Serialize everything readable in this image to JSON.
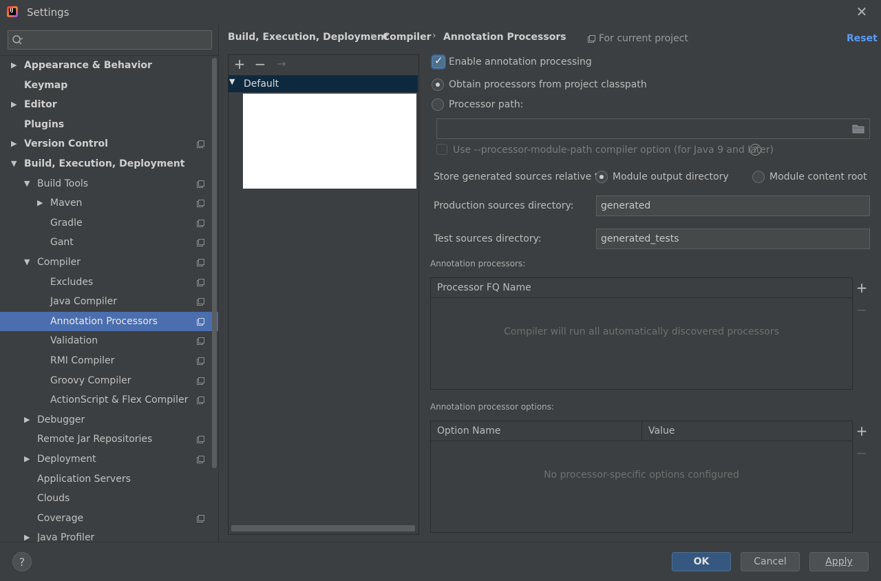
{
  "window": {
    "title": "Settings",
    "app_icon_text": "IJ"
  },
  "search": {
    "placeholder": ""
  },
  "sidebar": {
    "items": [
      {
        "label": "Appearance & Behavior",
        "bold": true,
        "arrow": "▶"
      },
      {
        "label": "Keymap",
        "bold": true
      },
      {
        "label": "Editor",
        "bold": true,
        "arrow": "▶"
      },
      {
        "label": "Plugins",
        "bold": true
      },
      {
        "label": "Version Control",
        "bold": true,
        "arrow": "▶",
        "copy": true
      },
      {
        "label": "Build, Execution, Deployment",
        "bold": true,
        "arrow": "▼"
      },
      {
        "label": "Build Tools",
        "arrow": "▼",
        "copy": true
      },
      {
        "label": "Maven",
        "arrow": "▶",
        "copy": true
      },
      {
        "label": "Gradle",
        "copy": true
      },
      {
        "label": "Gant",
        "copy": true
      },
      {
        "label": "Compiler",
        "arrow": "▼",
        "copy": true
      },
      {
        "label": "Excludes",
        "copy": true
      },
      {
        "label": "Java Compiler",
        "copy": true
      },
      {
        "label": "Annotation Processors",
        "copy": true,
        "selected": true
      },
      {
        "label": "Validation",
        "copy": true
      },
      {
        "label": "RMI Compiler",
        "copy": true
      },
      {
        "label": "Groovy Compiler",
        "copy": true
      },
      {
        "label": "ActionScript & Flex Compiler",
        "copy": true
      },
      {
        "label": "Debugger",
        "arrow": "▶"
      },
      {
        "label": "Remote Jar Repositories",
        "copy": true
      },
      {
        "label": "Deployment",
        "arrow": "▶",
        "copy": true
      },
      {
        "label": "Application Servers"
      },
      {
        "label": "Clouds"
      },
      {
        "label": "Coverage",
        "copy": true
      },
      {
        "label": "Java Profiler",
        "arrow": "▶"
      }
    ]
  },
  "breadcrumb": {
    "items": [
      "Build, Execution, Deployment",
      "Compiler",
      "Annotation Processors"
    ],
    "separator": "›",
    "scope_label": "For current project",
    "reset_label": "Reset"
  },
  "profiles": {
    "add_icon": "+",
    "remove_icon": "−",
    "move_icon": "→",
    "default_arrow": "▼",
    "default_label": "Default"
  },
  "settings": {
    "enable_label": "Enable annotation processing",
    "enable_checked": true,
    "obtain_label": "Obtain processors from project classpath",
    "processor_path_label": "Processor path:",
    "processor_path_value": "",
    "module_path_label": "Use --processor-module-path compiler option (for Java 9 and later)",
    "help_glyph": "?",
    "store_label": "Store generated sources relative to:",
    "module_output_label": "Module output directory",
    "module_content_label": "Module content root",
    "production_label": "Production sources directory:",
    "production_value": "generated",
    "test_label": "Test sources directory:",
    "test_value": "generated_tests"
  },
  "processors_table": {
    "section_label": "Annotation processors:",
    "column": "Processor FQ Name",
    "empty_text": "Compiler will run all automatically discovered processors",
    "add_icon": "+",
    "remove_icon": "−"
  },
  "options_table": {
    "section_label": "Annotation processor options:",
    "columns": [
      "Option Name",
      "Value"
    ],
    "empty_text": "No processor-specific options configured",
    "add_icon": "+",
    "remove_icon": "−"
  },
  "footer": {
    "help_glyph": "?",
    "ok_label": "OK",
    "cancel_label": "Cancel",
    "apply_label": "Apply"
  },
  "colors": {
    "accent": "#4b6eaf",
    "link": "#589df6",
    "background": "#3c3f41"
  }
}
